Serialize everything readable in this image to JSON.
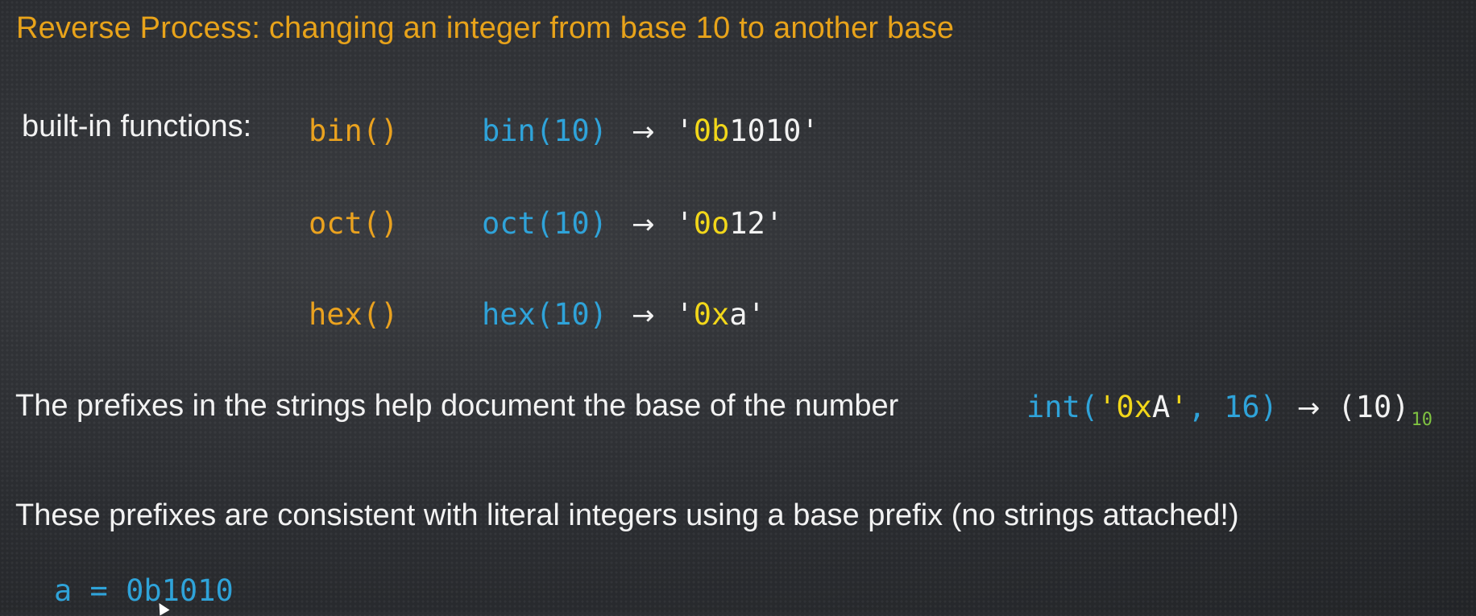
{
  "slide": {
    "title": "Reverse Process: changing an integer from base 10 to another base",
    "builtins_label": "built-in functions:",
    "arrow": "→",
    "functions": [
      {
        "name": "bin()",
        "call": "bin(10)",
        "quote_open": "'",
        "prefix": "0b",
        "digits": "1010",
        "quote_close": "'"
      },
      {
        "name": "oct()",
        "call": "oct(10)",
        "quote_open": "'",
        "prefix": "0o",
        "digits": "12",
        "quote_close": "'"
      },
      {
        "name": "hex()",
        "call": "hex(10)",
        "quote_open": "'",
        "prefix": "0x",
        "digits": "a",
        "quote_close": "'"
      }
    ],
    "prefix_sentence": "The prefixes in the strings help document the base of the number",
    "int_example": {
      "call_open": "int(",
      "quote_open": "'",
      "prefix": "0x",
      "digit": "A",
      "quote_close": "'",
      "rest": ", 16)",
      "result": "(10)",
      "subscript": "10"
    },
    "consistent_sentence": "These prefixes are consistent with literal integers using a base prefix (no strings attached!)",
    "literal_code": "a = 0b1010"
  },
  "colors": {
    "background": "#2e3034",
    "title": "#e8a31a",
    "function_name": "#eaa21f",
    "call": "#2fa3d9",
    "prefix": "#f2d71a",
    "text": "#f2f2f2",
    "subscript": "#7fc241"
  }
}
